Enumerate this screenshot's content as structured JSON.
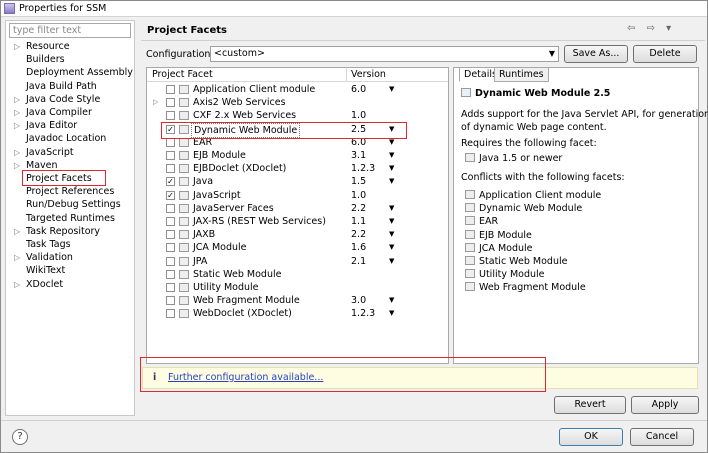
{
  "window": {
    "title": "Properties for SSM"
  },
  "filter": {
    "placeholder": "type filter text"
  },
  "tree": [
    {
      "label": "Resource",
      "expandable": true
    },
    {
      "label": "Builders",
      "expandable": false
    },
    {
      "label": "Deployment Assembly",
      "expandable": false
    },
    {
      "label": "Java Build Path",
      "expandable": false
    },
    {
      "label": "Java Code Style",
      "expandable": true
    },
    {
      "label": "Java Compiler",
      "expandable": true
    },
    {
      "label": "Java Editor",
      "expandable": true
    },
    {
      "label": "Javadoc Location",
      "expandable": false
    },
    {
      "label": "JavaScript",
      "expandable": true
    },
    {
      "label": "Maven",
      "expandable": true
    },
    {
      "label": "Project Facets",
      "expandable": false,
      "selected": true
    },
    {
      "label": "Project References",
      "expandable": false
    },
    {
      "label": "Run/Debug Settings",
      "expandable": false
    },
    {
      "label": "Targeted Runtimes",
      "expandable": false
    },
    {
      "label": "Task Repository",
      "expandable": true
    },
    {
      "label": "Task Tags",
      "expandable": false
    },
    {
      "label": "Validation",
      "expandable": true
    },
    {
      "label": "WikiText",
      "expandable": false
    },
    {
      "label": "XDoclet",
      "expandable": true
    }
  ],
  "page": {
    "title": "Project Facets",
    "nav_icons": "⇦ ⇨ ▾",
    "configuration_label": "Configuration:",
    "configuration_value": "<custom>",
    "save_as_label": "Save As...",
    "delete_label": "Delete"
  },
  "facets": {
    "col_facet": "Project Facet",
    "col_version": "Version",
    "rows": [
      {
        "name": "Application Client module",
        "version": "6.0",
        "checked": false,
        "dropdown": true,
        "expandable": false
      },
      {
        "name": "Axis2 Web Services",
        "version": "",
        "checked": false,
        "dropdown": false,
        "expandable": true
      },
      {
        "name": "CXF 2.x Web Services",
        "version": "1.0",
        "checked": false,
        "dropdown": false,
        "expandable": false
      },
      {
        "name": "Dynamic Web Module",
        "version": "2.5",
        "checked": true,
        "dropdown": true,
        "expandable": false,
        "selected": true
      },
      {
        "name": "EAR",
        "version": "6.0",
        "checked": false,
        "dropdown": true,
        "expandable": false
      },
      {
        "name": "EJB Module",
        "version": "3.1",
        "checked": false,
        "dropdown": true,
        "expandable": false
      },
      {
        "name": "EJBDoclet (XDoclet)",
        "version": "1.2.3",
        "checked": false,
        "dropdown": true,
        "expandable": false
      },
      {
        "name": "Java",
        "version": "1.5",
        "checked": true,
        "dropdown": true,
        "expandable": false
      },
      {
        "name": "JavaScript",
        "version": "1.0",
        "checked": true,
        "dropdown": false,
        "expandable": false
      },
      {
        "name": "JavaServer Faces",
        "version": "2.2",
        "checked": false,
        "dropdown": true,
        "expandable": false
      },
      {
        "name": "JAX-RS (REST Web Services)",
        "version": "1.1",
        "checked": false,
        "dropdown": true,
        "expandable": false
      },
      {
        "name": "JAXB",
        "version": "2.2",
        "checked": false,
        "dropdown": true,
        "expandable": false
      },
      {
        "name": "JCA Module",
        "version": "1.6",
        "checked": false,
        "dropdown": true,
        "expandable": false
      },
      {
        "name": "JPA",
        "version": "2.1",
        "checked": false,
        "dropdown": true,
        "expandable": false
      },
      {
        "name": "Static Web Module",
        "version": "",
        "checked": false,
        "dropdown": false,
        "expandable": false
      },
      {
        "name": "Utility Module",
        "version": "",
        "checked": false,
        "dropdown": false,
        "expandable": false
      },
      {
        "name": "Web Fragment Module",
        "version": "3.0",
        "checked": false,
        "dropdown": true,
        "expandable": false
      },
      {
        "name": "WebDoclet (XDoclet)",
        "version": "1.2.3",
        "checked": false,
        "dropdown": true,
        "expandable": false
      }
    ]
  },
  "details": {
    "tab_details": "Details",
    "tab_runtimes": "Runtimes",
    "heading": "Dynamic Web Module 2.5",
    "description_line1": "Adds support for the Java Servlet API, for generation",
    "description_line2": "of dynamic Web page content.",
    "requires_label": "Requires the following facet:",
    "requires": [
      "Java 1.5 or newer"
    ],
    "conflicts_label": "Conflicts with the following facets:",
    "conflicts": [
      "Application Client module",
      "Dynamic Web Module",
      "EAR",
      "EJB Module",
      "JCA Module",
      "Static Web Module",
      "Utility Module",
      "Web Fragment Module"
    ]
  },
  "info": {
    "icon": "i",
    "link": "Further configuration available..."
  },
  "buttons": {
    "revert": "Revert",
    "apply": "Apply",
    "ok": "OK",
    "cancel": "Cancel",
    "help": "?"
  },
  "colors": {
    "highlight_box": "#e0272f",
    "link": "#2741c8",
    "info_bg": "#fffde1"
  }
}
